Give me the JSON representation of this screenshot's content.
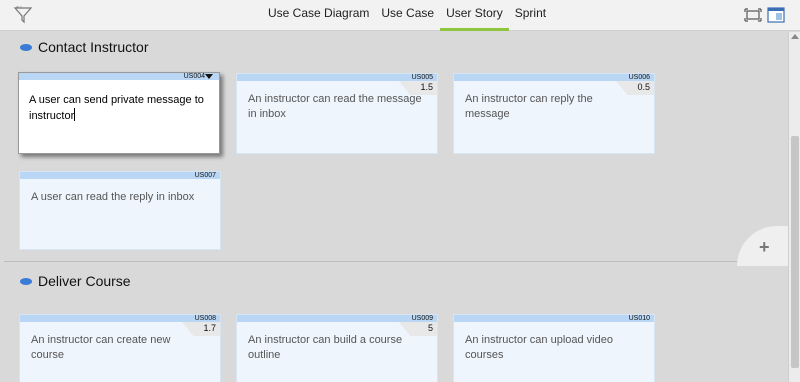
{
  "toolbar": {
    "tabs": [
      {
        "label": "Use Case Diagram",
        "active": false
      },
      {
        "label": "Use Case",
        "active": false
      },
      {
        "label": "User Story",
        "active": true
      },
      {
        "label": "Sprint",
        "active": false
      }
    ],
    "accent_color": "#8ec63f"
  },
  "groups": [
    {
      "title": "Contact Instructor",
      "cards": [
        {
          "id": "US004",
          "text": "A user can send private message to instructor",
          "points": "",
          "editing": true
        },
        {
          "id": "US005",
          "text": "An instructor can read the message in inbox",
          "points": "1.5"
        },
        {
          "id": "US006",
          "text": "An instructor can reply the message",
          "points": "0.5"
        },
        {
          "id": "US007",
          "text": "A user can read the reply in inbox",
          "points": ""
        }
      ]
    },
    {
      "title": "Deliver Course",
      "cards": [
        {
          "id": "US008",
          "text": "An instructor can create new course",
          "points": "1.7"
        },
        {
          "id": "US009",
          "text": "An instructor can build a course outline",
          "points": "5"
        },
        {
          "id": "US010",
          "text": "An instructor can upload video courses",
          "points": ""
        }
      ]
    }
  ],
  "add_button": {
    "icon": "plus-icon"
  }
}
